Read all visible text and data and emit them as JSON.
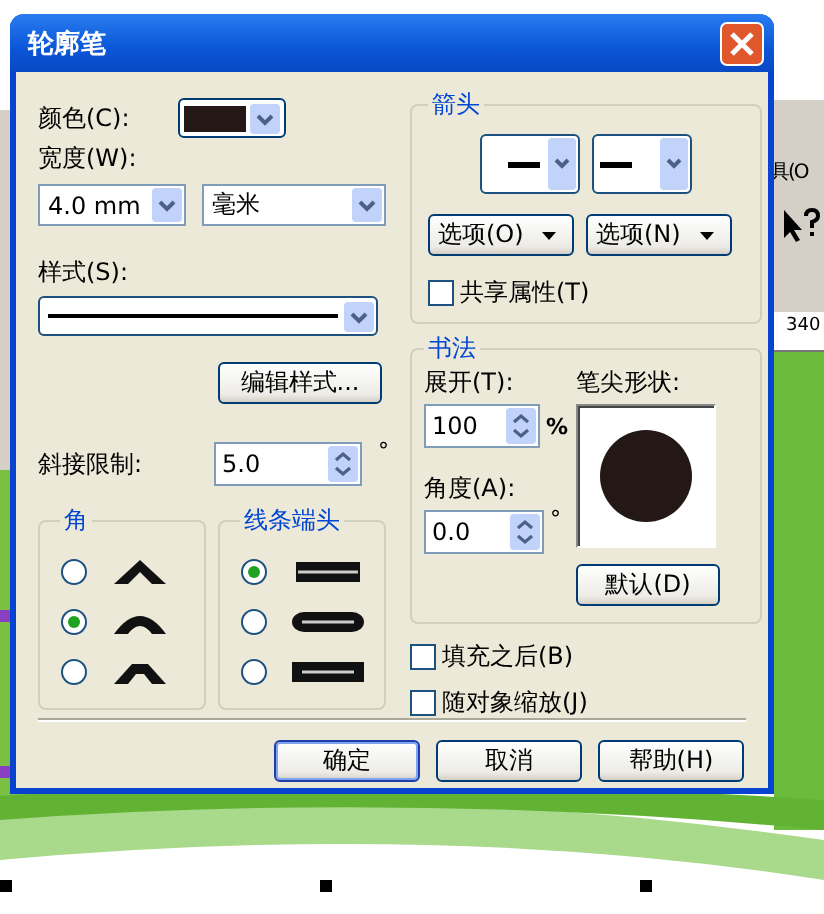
{
  "window": {
    "title": "轮廓笔"
  },
  "pen_color": {
    "label": "颜色(C):",
    "color": "#231815"
  },
  "width": {
    "label": "宽度(W):",
    "value": "4.0 mm",
    "unit": "毫米"
  },
  "style": {
    "label": "样式(S):",
    "edit_button": "编辑样式..."
  },
  "miter": {
    "label": "斜接限制:",
    "value": "5.0",
    "unit": "°"
  },
  "corners": {
    "title": "角",
    "options": [
      {
        "kind": "miter",
        "selected": false
      },
      {
        "kind": "round",
        "selected": true
      },
      {
        "kind": "bevel",
        "selected": false
      }
    ]
  },
  "caps": {
    "title": "线条端头",
    "options": [
      {
        "kind": "butt",
        "selected": true
      },
      {
        "kind": "round",
        "selected": false
      },
      {
        "kind": "square",
        "selected": false
      }
    ]
  },
  "arrows": {
    "title": "箭头",
    "option_buttons": [
      "选项(O)",
      "选项(N)"
    ],
    "share": {
      "label": "共享属性(T)",
      "checked": false
    }
  },
  "calligraphy": {
    "title": "书法",
    "stretch": {
      "label": "展开(T):",
      "value": "100",
      "unit": "%"
    },
    "nib_label": "笔尖形状:",
    "angle": {
      "label": "角度(A):",
      "value": "0.0",
      "unit": "°"
    },
    "default_button": "默认(D)"
  },
  "options": [
    {
      "label": "填充之后(B)",
      "checked": false
    },
    {
      "label": "随对象缩放(J)",
      "checked": false
    }
  ],
  "buttons": [
    "确定",
    "取消",
    "帮助(H)"
  ],
  "background": {
    "menu_fragment": "具(O",
    "ruler_label": "340"
  }
}
